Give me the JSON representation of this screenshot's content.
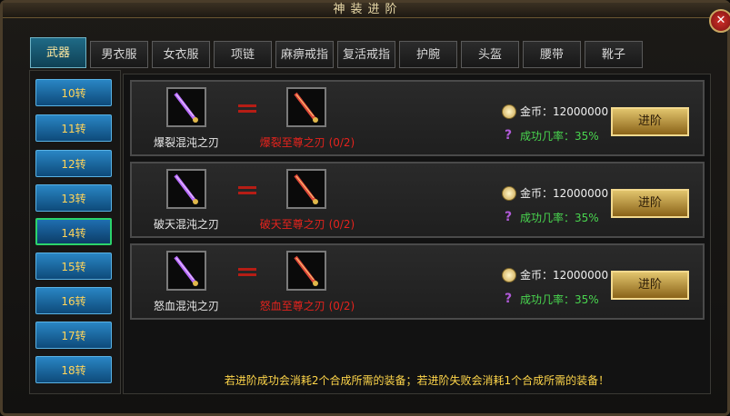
{
  "window": {
    "title": "神装进阶",
    "close_symbol": "✕"
  },
  "tabs": [
    {
      "label": "武器",
      "active": true
    },
    {
      "label": "男衣服"
    },
    {
      "label": "女衣服"
    },
    {
      "label": "项链"
    },
    {
      "label": "麻痹戒指"
    },
    {
      "label": "复活戒指"
    },
    {
      "label": "护腕"
    },
    {
      "label": "头盔"
    },
    {
      "label": "腰带"
    },
    {
      "label": "靴子"
    }
  ],
  "turns": [
    "10转",
    "11转",
    "12转",
    "13转",
    "14转",
    "15转",
    "16转",
    "17转",
    "18转"
  ],
  "selected_turn": "14转",
  "rows": [
    {
      "source_name": "爆裂混沌之刃",
      "target_name": "爆裂至尊之刃 (0/2)",
      "gold_label": "金币：12000000",
      "rate_label": "成功几率：35%",
      "button": "进阶"
    },
    {
      "source_name": "破天混沌之刃",
      "target_name": "破天至尊之刃 (0/2)",
      "gold_label": "金币：12000000",
      "rate_label": "成功几率：35%",
      "button": "进阶"
    },
    {
      "source_name": "怒血混沌之刃",
      "target_name": "怒血至尊之刃 (0/2)",
      "gold_label": "金币：12000000",
      "rate_label": "成功几率：35%",
      "button": "进阶"
    }
  ],
  "note": "若进阶成功会消耗2个合成所需的装备；若进阶失败会消耗1个合成所需的装备！",
  "colors": {
    "accent_gold": "#ffd64a",
    "success_green": "#49d64f",
    "target_red": "#e5231d"
  }
}
